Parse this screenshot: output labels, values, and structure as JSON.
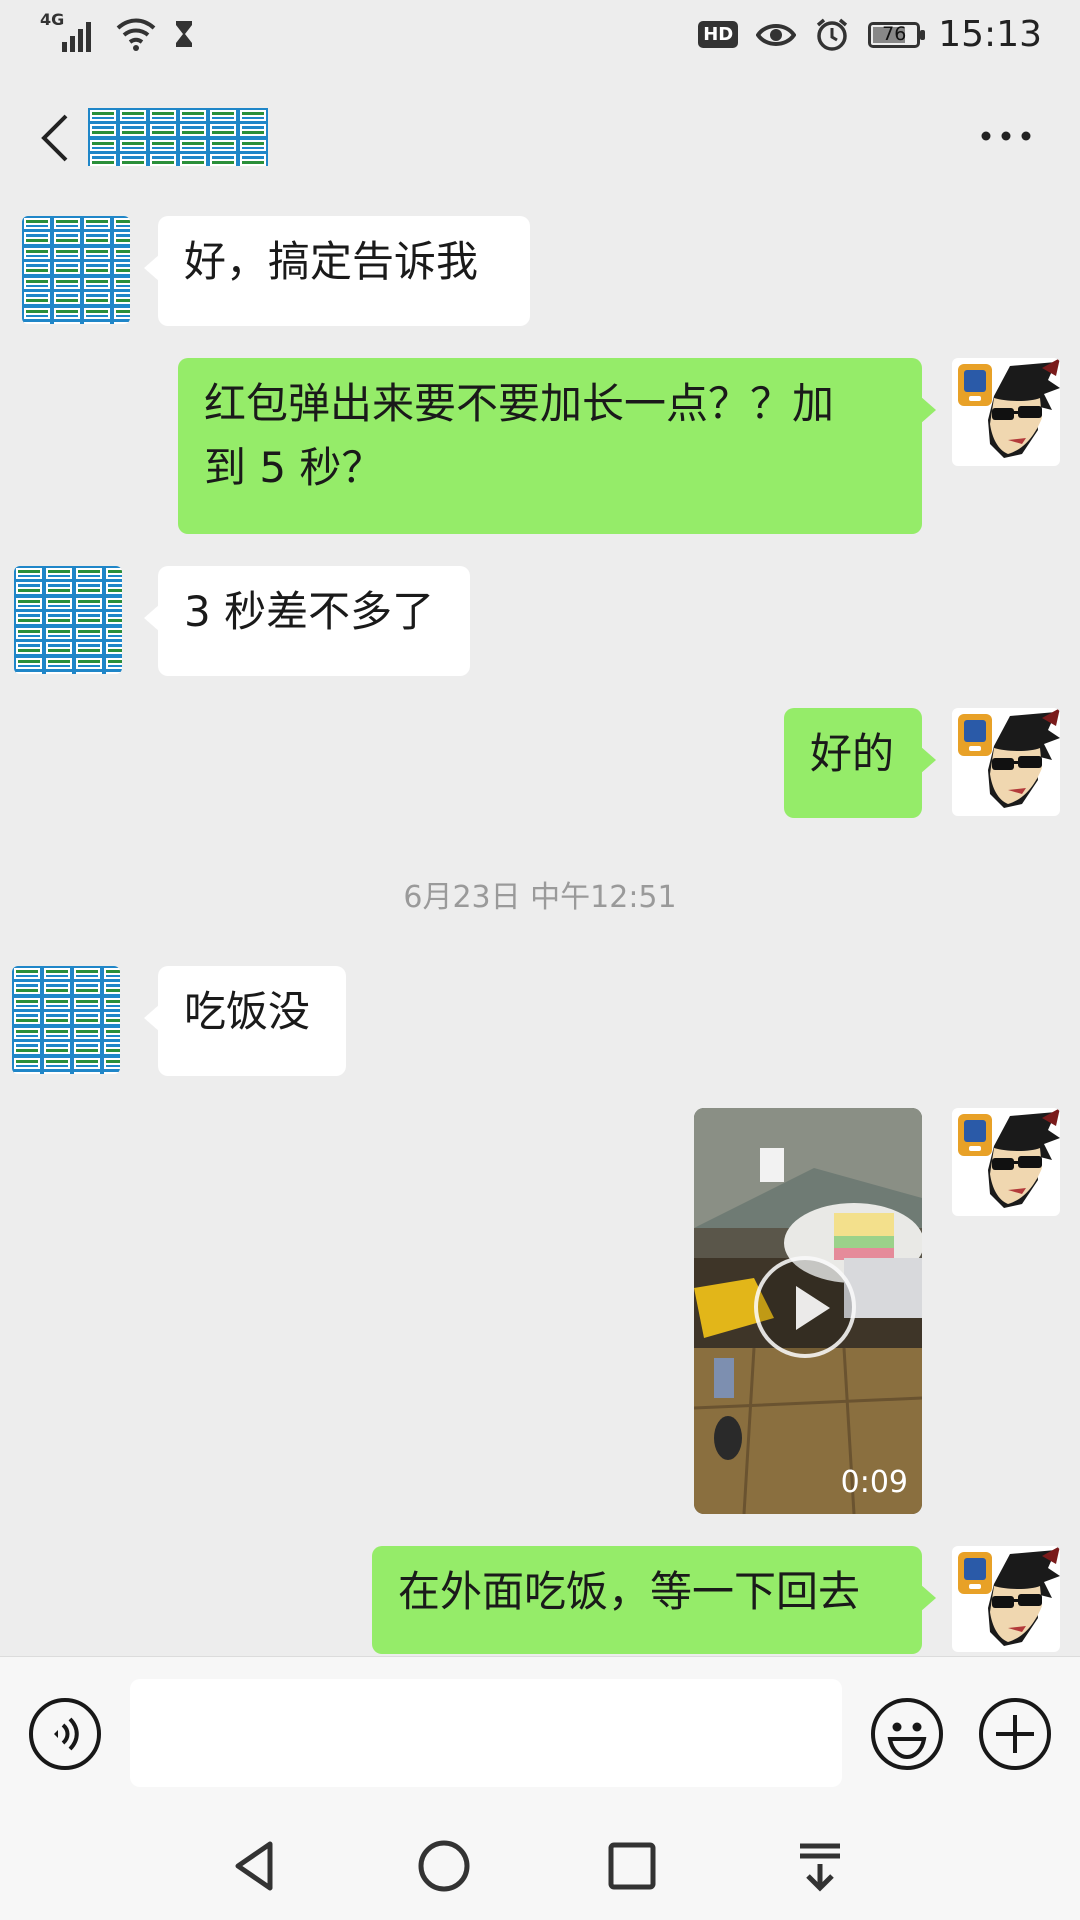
{
  "status_bar": {
    "network": "4G",
    "hd_label": "HD",
    "battery_level": 76,
    "battery_text": "76",
    "time": "15:13"
  },
  "header": {
    "back_icon": "chevron-left-icon",
    "more_icon": "ellipsis-icon"
  },
  "messages": [
    {
      "side": "left",
      "type": "text",
      "text": "好，搞定告诉我"
    },
    {
      "side": "right",
      "type": "text",
      "line1": "红包弹出来要不要加长一点？？加",
      "line2": "到 5 秒？"
    },
    {
      "side": "left",
      "type": "text",
      "text": "3 秒差不多了"
    },
    {
      "side": "right",
      "type": "text",
      "text": "好的"
    },
    {
      "type": "timestamp",
      "text": "6月23日 中午12:51"
    },
    {
      "side": "left",
      "type": "text",
      "text": "吃饭没"
    },
    {
      "side": "right",
      "type": "video",
      "duration": "0:09"
    },
    {
      "side": "right",
      "type": "text",
      "text": "在外面吃饭，等一下回去"
    }
  ],
  "input_bar": {
    "voice_icon": "voice-icon",
    "emoji_icon": "emoji-icon",
    "plus_icon": "plus-icon",
    "text_value": ""
  },
  "nav_bar": {
    "back_icon": "triangle-back-icon",
    "home_icon": "circle-home-icon",
    "recents_icon": "square-recents-icon",
    "notifications_icon": "pull-down-icon"
  },
  "colors": {
    "background": "#ededed",
    "bubble_self": "#95ec69",
    "bubble_other": "#ffffff"
  }
}
